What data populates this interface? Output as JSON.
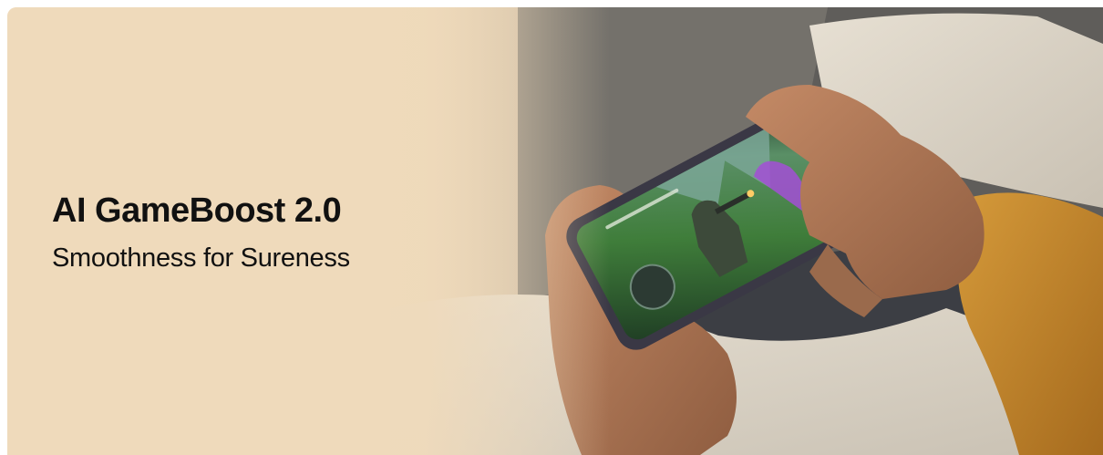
{
  "banner": {
    "headline": "AI GameBoost 2.0",
    "subheadline": "Smoothness for Sureness"
  },
  "image": {
    "subject": "phone-gaming-photo",
    "accent_colors": {
      "background_beige": "#efdabb",
      "sweater_mustard": "#c68a2c",
      "skin": "#b07a58",
      "phone_frame": "#3a3845",
      "game_green": "#3f7d3a",
      "game_purple": "#a34fd6"
    }
  }
}
